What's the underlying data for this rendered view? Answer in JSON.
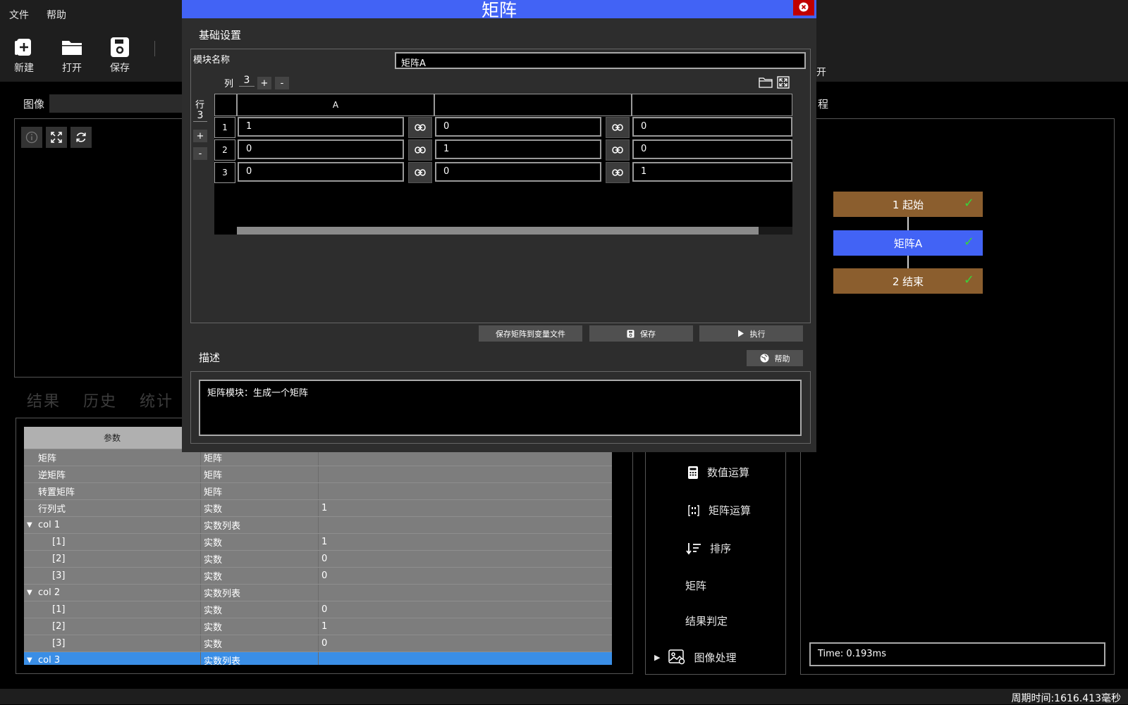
{
  "menu": {
    "file": "文件",
    "help": "帮助"
  },
  "toolbar": {
    "new": "新建",
    "open": "打开",
    "save": "保存",
    "partial_right": "开"
  },
  "image_panel": {
    "label": "图像"
  },
  "result_tabs": {
    "result": "结果",
    "history": "历史",
    "stats": "统计"
  },
  "param_table": {
    "header": "参数",
    "rows": [
      {
        "name": "矩阵",
        "type": "矩阵",
        "value": ""
      },
      {
        "name": "逆矩阵",
        "type": "矩阵",
        "value": ""
      },
      {
        "name": "转置矩阵",
        "type": "矩阵",
        "value": ""
      },
      {
        "name": "行列式",
        "type": "实数",
        "value": "1"
      },
      {
        "name": "col 1",
        "type": "实数列表",
        "value": ""
      },
      {
        "name": "[1]",
        "type": "实数",
        "value": "1"
      },
      {
        "name": "[2]",
        "type": "实数",
        "value": "0"
      },
      {
        "name": "[3]",
        "type": "实数",
        "value": "0"
      },
      {
        "name": "col 2",
        "type": "实数列表",
        "value": ""
      },
      {
        "name": "[1]",
        "type": "实数",
        "value": "0"
      },
      {
        "name": "[2]",
        "type": "实数",
        "value": "1"
      },
      {
        "name": "[3]",
        "type": "实数",
        "value": "0"
      },
      {
        "name": "col 3",
        "type": "实数列表",
        "value": ""
      }
    ]
  },
  "tools": {
    "numeric": "数值运算",
    "matrix_op": "矩阵运算",
    "sort": "排序",
    "matrix": "矩阵",
    "judge": "结果判定",
    "image_proc": "图像处理"
  },
  "flow": {
    "label": "程",
    "nodes": [
      {
        "label": "1 起始",
        "color": "#8b5e2e"
      },
      {
        "label": "矩阵A",
        "color": "#4263f5"
      },
      {
        "label": "2 结束",
        "color": "#8b5e2e"
      }
    ],
    "check": "✓",
    "time": "Time: 0.193ms"
  },
  "status": {
    "cycle": "周期时间:1616.413毫秒"
  },
  "dialog": {
    "title": "矩阵",
    "basic_section": "基础设置",
    "name_label": "模块名称",
    "name_value": "矩阵A",
    "col_label": "列",
    "col_count": "3",
    "row_label": "行",
    "row_count": "3",
    "plus": "+",
    "minus": "-",
    "col_headers": [
      "A",
      "",
      ""
    ],
    "row_headers": [
      "1",
      "2",
      "3"
    ],
    "matrix": [
      [
        "1",
        "0",
        "0"
      ],
      [
        "0",
        "1",
        "0"
      ],
      [
        "0",
        "0",
        "1"
      ]
    ],
    "btn_save_file": "保存矩阵到变量文件",
    "btn_save": "保存",
    "btn_run": "执行",
    "desc_section": "描述",
    "btn_help": "帮助",
    "description": "矩阵模块：生成一个矩阵"
  }
}
